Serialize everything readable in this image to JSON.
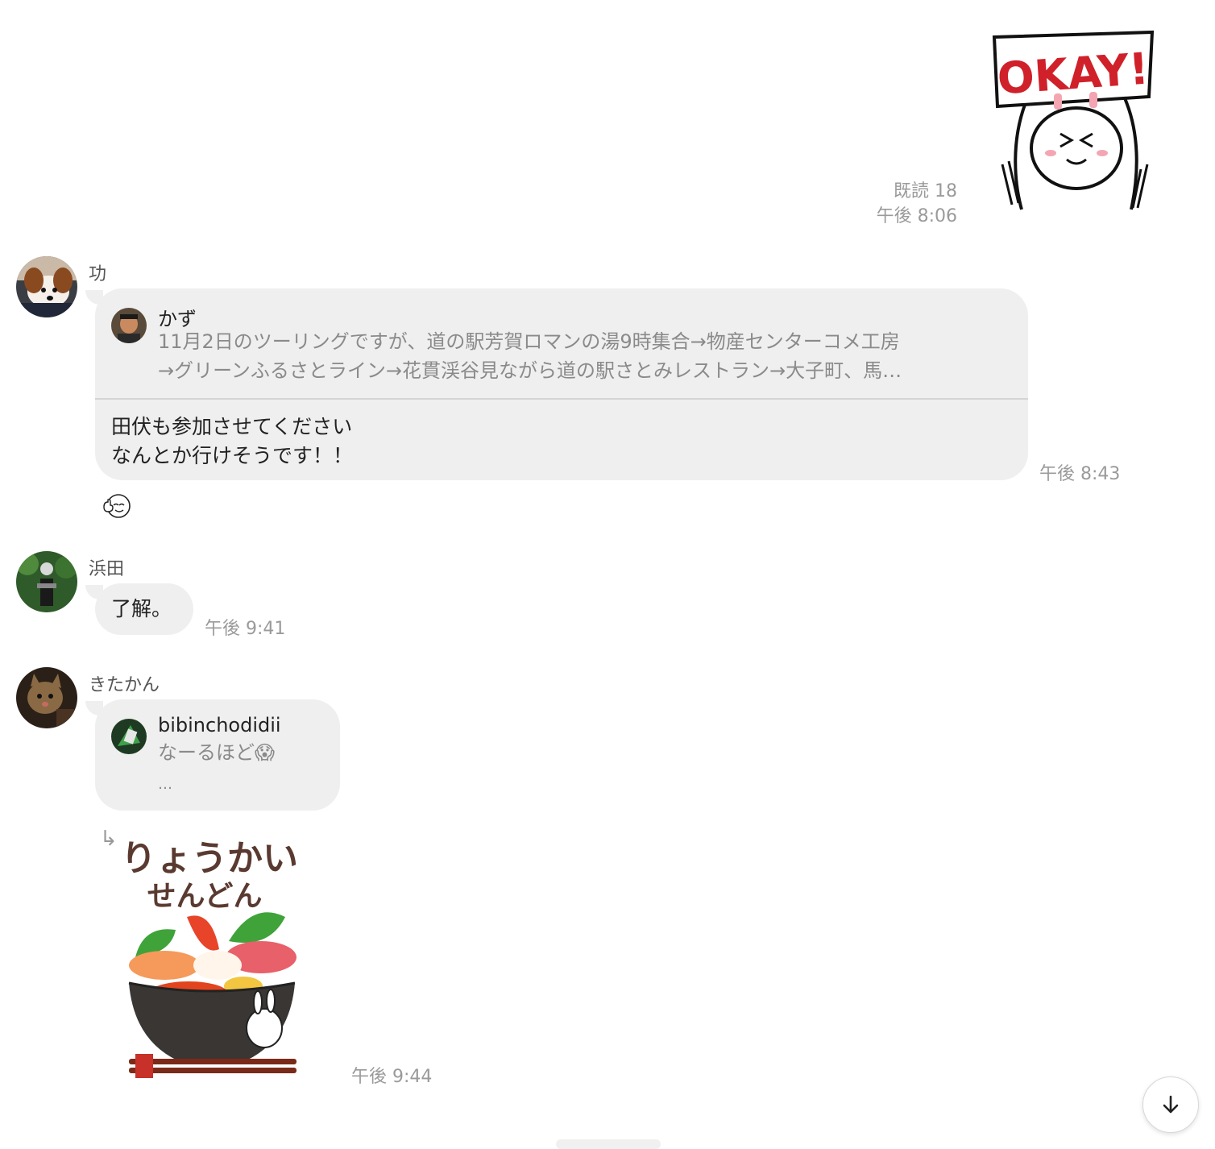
{
  "sent_message": {
    "read_label": "既読 18",
    "time": "午後 8:06",
    "sticker_text": "OKAY!"
  },
  "messages": [
    {
      "sender": "功",
      "quote": {
        "author": "かず",
        "line1": "11月2日のツーリングですが、道の駅芳賀ロマンの湯9時集合→物産センターコメ工房",
        "line2": "→グリーンふるさとライン→花貫渓谷見ながら道の駅さとみレストラン→大子町、馬…"
      },
      "text_line1": "田伏も参加させてください",
      "text_line2": "なんとか行けそうです！！",
      "time": "午後 8:43"
    },
    {
      "sender": "浜田",
      "text": "了解。",
      "time": "午後 9:41"
    },
    {
      "sender": "きたかん",
      "quote": {
        "author": "bibinchodidii",
        "line1": "なーるほど😱",
        "line2": "…"
      },
      "reply_arrow": "↳",
      "sticker_text_line1": "りょうかい",
      "sticker_text_line2": "せんどん",
      "time": "午後 9:44"
    }
  ],
  "colors": {
    "bubble": "#efefef",
    "timestamp": "#9a9a9a",
    "okay_red": "#d0202a"
  },
  "icons": {
    "scroll_down": "arrow-down-icon",
    "reaction": "thumbs-up-face-icon"
  }
}
